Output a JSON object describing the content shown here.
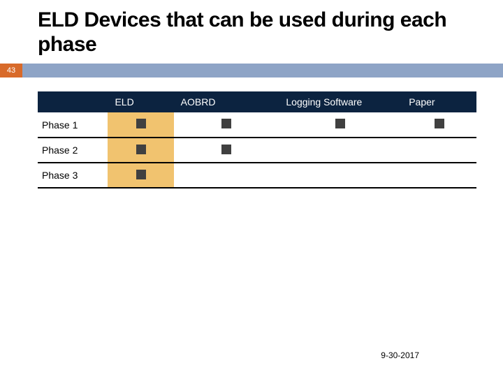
{
  "slide": {
    "title": "ELD Devices that can be used during each phase",
    "number": "43",
    "footer_date": "9-30-2017"
  },
  "table": {
    "columns": {
      "eld": "ELD",
      "aobrd": "AOBRD",
      "logging": "Logging Software",
      "paper": "Paper"
    },
    "rows": {
      "phase1": "Phase 1",
      "phase2": "Phase 2",
      "phase3": "Phase 3"
    }
  },
  "chart_data": {
    "type": "table",
    "title": "ELD Devices that can be used during each phase",
    "columns": [
      "ELD",
      "AOBRD",
      "Logging Software",
      "Paper"
    ],
    "rows": [
      "Phase 1",
      "Phase 2",
      "Phase 3"
    ],
    "matrix": [
      [
        true,
        true,
        true,
        true
      ],
      [
        true,
        true,
        false,
        false
      ],
      [
        true,
        false,
        false,
        false
      ]
    ]
  }
}
